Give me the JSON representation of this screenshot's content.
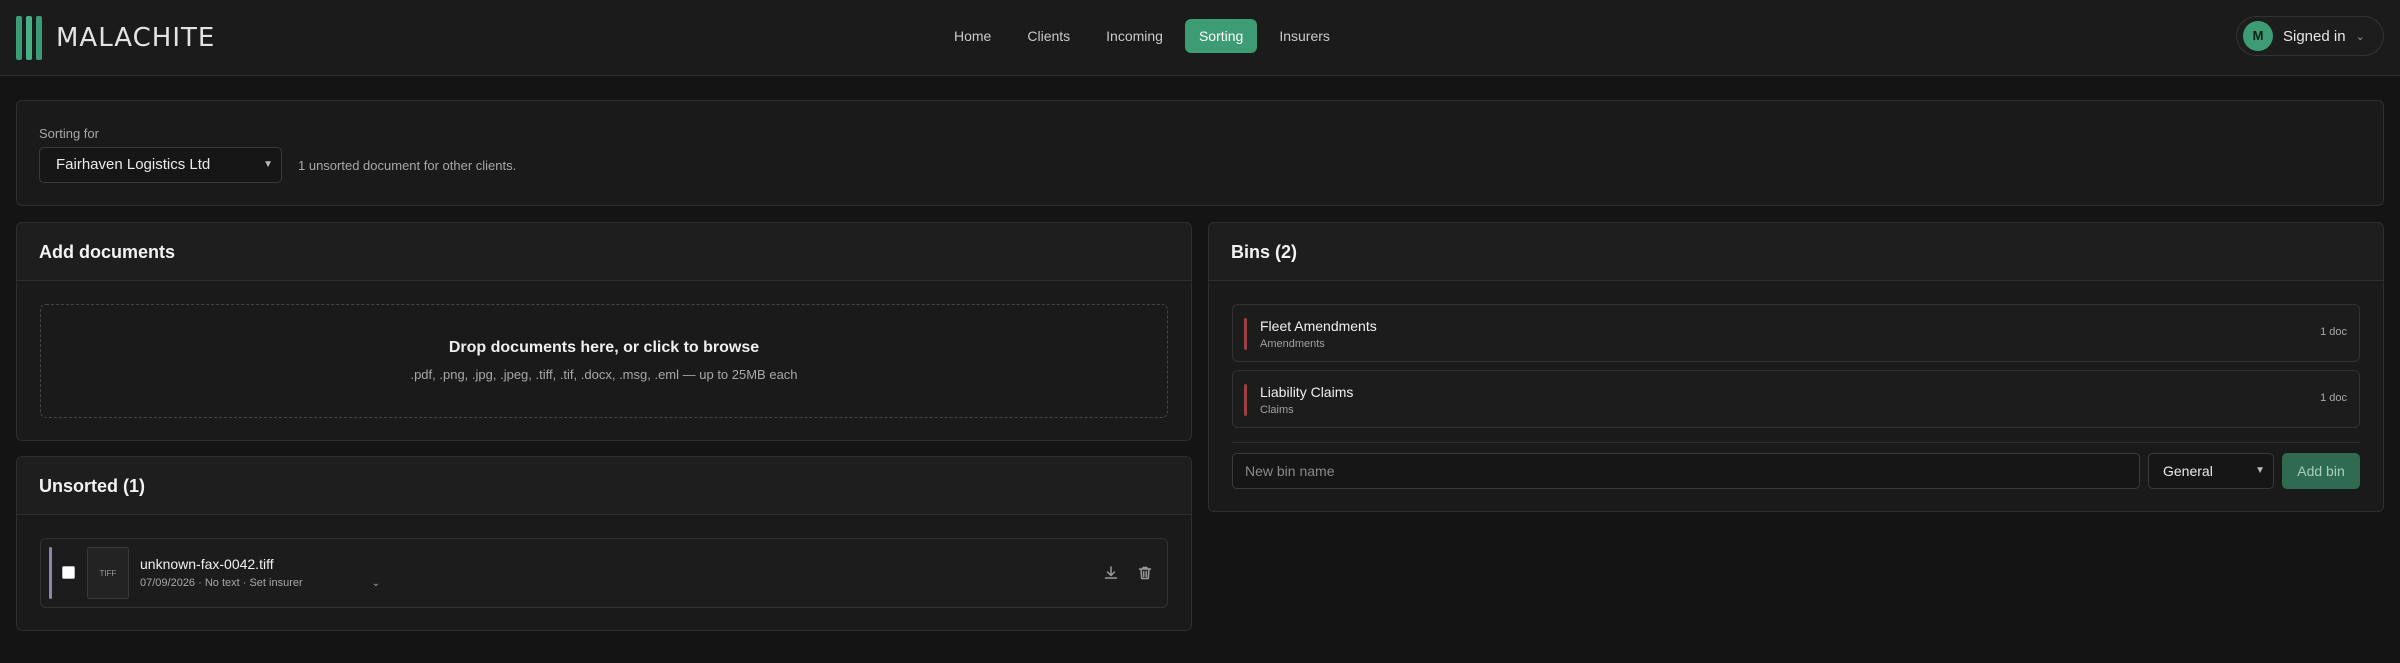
{
  "header": {
    "logo_text": "MALACHITE",
    "nav": [
      {
        "label": "Home"
      },
      {
        "label": "Clients"
      },
      {
        "label": "Incoming"
      },
      {
        "label": "Sorting"
      },
      {
        "label": "Insurers"
      }
    ],
    "active_nav": "Sorting",
    "account": {
      "initial": "M",
      "label": "Signed in"
    }
  },
  "sorting_for": {
    "label": "Sorting for",
    "selected_client": "Fairhaven Logistics Ltd",
    "note": "1 unsorted document for other clients."
  },
  "add_documents": {
    "title": "Add documents",
    "drop_title": "Drop documents here, or click to browse",
    "drop_subtitle": ".pdf, .png, .jpg, .jpeg, .tiff, .tif, .docx, .msg, .eml — up to 25MB each"
  },
  "unsorted": {
    "title": "Unsorted (1)",
    "documents": [
      {
        "thumb_label": "TIFF",
        "name": "unknown-fax-0042.tiff",
        "meta": "07/09/2026 · No text · Set insurer"
      }
    ]
  },
  "bins": {
    "title": "Bins (2)",
    "items": [
      {
        "name": "Fleet Amendments",
        "category": "Amendments",
        "count": "1 doc"
      },
      {
        "name": "Liability Claims",
        "category": "Claims",
        "count": "1 doc"
      }
    ],
    "new_bin_placeholder": "New bin name",
    "category_value": "General",
    "add_label": "Add bin"
  },
  "colors": {
    "accent": "#3d9c74",
    "bin_accent": "#9c4040",
    "background": "#141414"
  }
}
